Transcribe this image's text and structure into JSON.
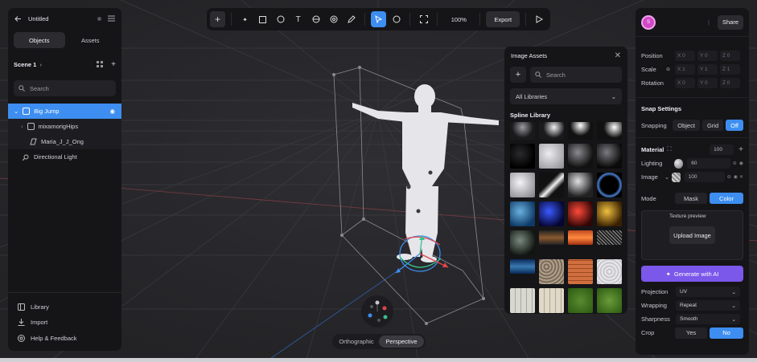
{
  "colors": {
    "accent": "#3d8ef0",
    "panel": "#151518",
    "canvas": "#27272b",
    "generate": "#7b57ea",
    "avatar": "#d148c7"
  },
  "left_panel": {
    "title": "Untitled",
    "tabs": [
      {
        "label": "Objects"
      },
      {
        "label": "Assets"
      }
    ],
    "scene": "Scene 1",
    "search_placeholder": "Search",
    "tree": [
      {
        "label": "Big Jump",
        "icon": "group-icon",
        "selected": true
      },
      {
        "label": "mixamorigHips",
        "icon": "bone-icon"
      },
      {
        "label": "Maria_J_J_Ong",
        "icon": "mesh-icon"
      },
      {
        "label": "Directional Light",
        "icon": "light-icon"
      }
    ],
    "bottom": [
      {
        "label": "Library",
        "icon": "library-icon"
      },
      {
        "label": "Import",
        "icon": "import-icon"
      },
      {
        "label": "Help & Feedback",
        "icon": "help-icon"
      }
    ]
  },
  "toolbar": {
    "tools": [
      "plus-icon",
      "magic-icon",
      "rectangle-icon",
      "ellipse-icon",
      "text-icon",
      "shape-icon",
      "sphere-icon",
      "pen-icon",
      "pointer-icon",
      "comment-icon",
      "frame-icon"
    ],
    "zoom": "100%",
    "export_label": "Export",
    "play_icon": "play-icon"
  },
  "image_assets": {
    "title": "Image Assets",
    "search_placeholder": "Search",
    "library_select": "All Libraries",
    "section": "Spline Library"
  },
  "right_panel": {
    "avatar_letter": "S",
    "share_label": "Share",
    "transform": [
      {
        "label": "Position",
        "values": [
          "X 0",
          "Y 0",
          "Z 0"
        ]
      },
      {
        "label": "Scale",
        "values": [
          "X 1",
          "Y 1",
          "Z 1"
        ]
      },
      {
        "label": "Rotation",
        "values": [
          "X 0",
          "Y 0",
          "Z 0"
        ]
      }
    ],
    "snap_title": "Snap Settings",
    "snapping_label": "Snapping",
    "snap_options": [
      "Object",
      "Grid",
      "Off"
    ],
    "material_title": "Material",
    "material_opacity": "100",
    "lighting_label": "Lighting",
    "lighting_value": "60",
    "image_label": "Image",
    "image_value": "100",
    "mode_label": "Mode",
    "mode_options": [
      "Mask",
      "Color"
    ],
    "texture_alt": "Texture preview",
    "upload_label": "Upload Image",
    "generate_label": "Generate with AI",
    "projection_label": "Projection",
    "projection_value": "UV",
    "wrapping_label": "Wrapping",
    "wrapping_value": "Repeat",
    "sharpness_label": "Sharpness",
    "sharpness_value": "Smooth",
    "crop_label": "Crop",
    "crop_options": [
      "Yes",
      "No"
    ]
  },
  "camera_toggle": {
    "options": [
      "Orthographic",
      "Perspective"
    ]
  }
}
